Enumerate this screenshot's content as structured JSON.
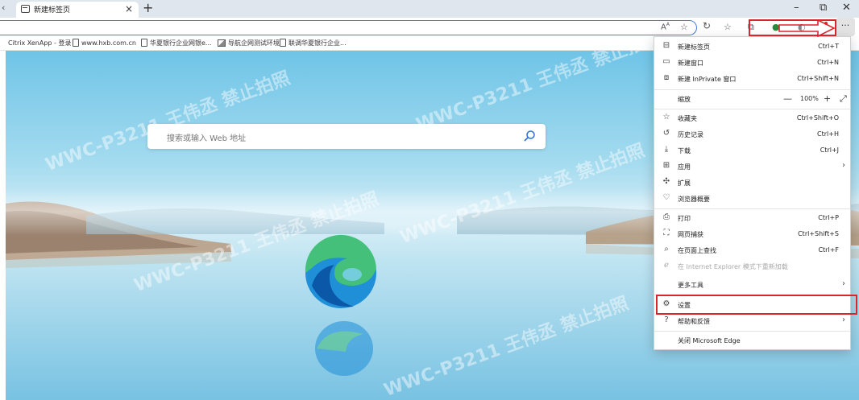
{
  "tab": {
    "title": "新建标签页",
    "close": "×",
    "new": "+"
  },
  "window": {
    "minimize": "–",
    "restore": "⧉",
    "close": "✕"
  },
  "toolbar": {
    "read_aloud": "A",
    "more": "···"
  },
  "favorites": [
    {
      "label": "Citrix XenApp - 登录",
      "icon": "none"
    },
    {
      "label": "www.hxb.com.cn",
      "icon": "page-icon"
    },
    {
      "label": "华夏银行企业网银e...",
      "icon": "page-icon"
    },
    {
      "label": "导航企网测试环境",
      "icon": "image-icon"
    },
    {
      "label": "联调华夏银行企业...",
      "icon": "page-icon"
    }
  ],
  "search": {
    "placeholder": "搜索或输入 Web 地址"
  },
  "watermark": {
    "text": "WWC-P3211 王伟丞 禁止拍照"
  },
  "menu": {
    "new_tab": {
      "label": "新建标签页",
      "shortcut": "Ctrl+T"
    },
    "new_window": {
      "label": "新建窗口",
      "shortcut": "Ctrl+N"
    },
    "new_inprivate": {
      "label": "新建 InPrivate 窗口",
      "shortcut": "Ctrl+Shift+N"
    },
    "zoom": {
      "label": "缩放",
      "value": "100%",
      "minus": "—",
      "plus": "+",
      "fullscreen": "⤢"
    },
    "favorites": {
      "label": "收藏夹",
      "shortcut": "Ctrl+Shift+O"
    },
    "history": {
      "label": "历史记录",
      "shortcut": "Ctrl+H"
    },
    "downloads": {
      "label": "下载",
      "shortcut": "Ctrl+J"
    },
    "apps": {
      "label": "应用"
    },
    "extensions": {
      "label": "扩展"
    },
    "browser_essentials": {
      "label": "浏览器概要"
    },
    "print": {
      "label": "打印",
      "shortcut": "Ctrl+P"
    },
    "web_capture": {
      "label": "网页捕获",
      "shortcut": "Ctrl+Shift+S"
    },
    "find": {
      "label": "在页面上查找",
      "shortcut": "Ctrl+F"
    },
    "ie_mode": {
      "label": "在 Internet Explorer 模式下重新加载"
    },
    "more_tools": {
      "label": "更多工具"
    },
    "settings": {
      "label": "设置"
    },
    "help": {
      "label": "帮助和反馈"
    },
    "close_edge": {
      "label": "关闭 Microsoft Edge"
    }
  },
  "colors": {
    "highlight": "#d9262c",
    "address_border": "#4a7ad9",
    "menu_bg": "#ffffff"
  }
}
